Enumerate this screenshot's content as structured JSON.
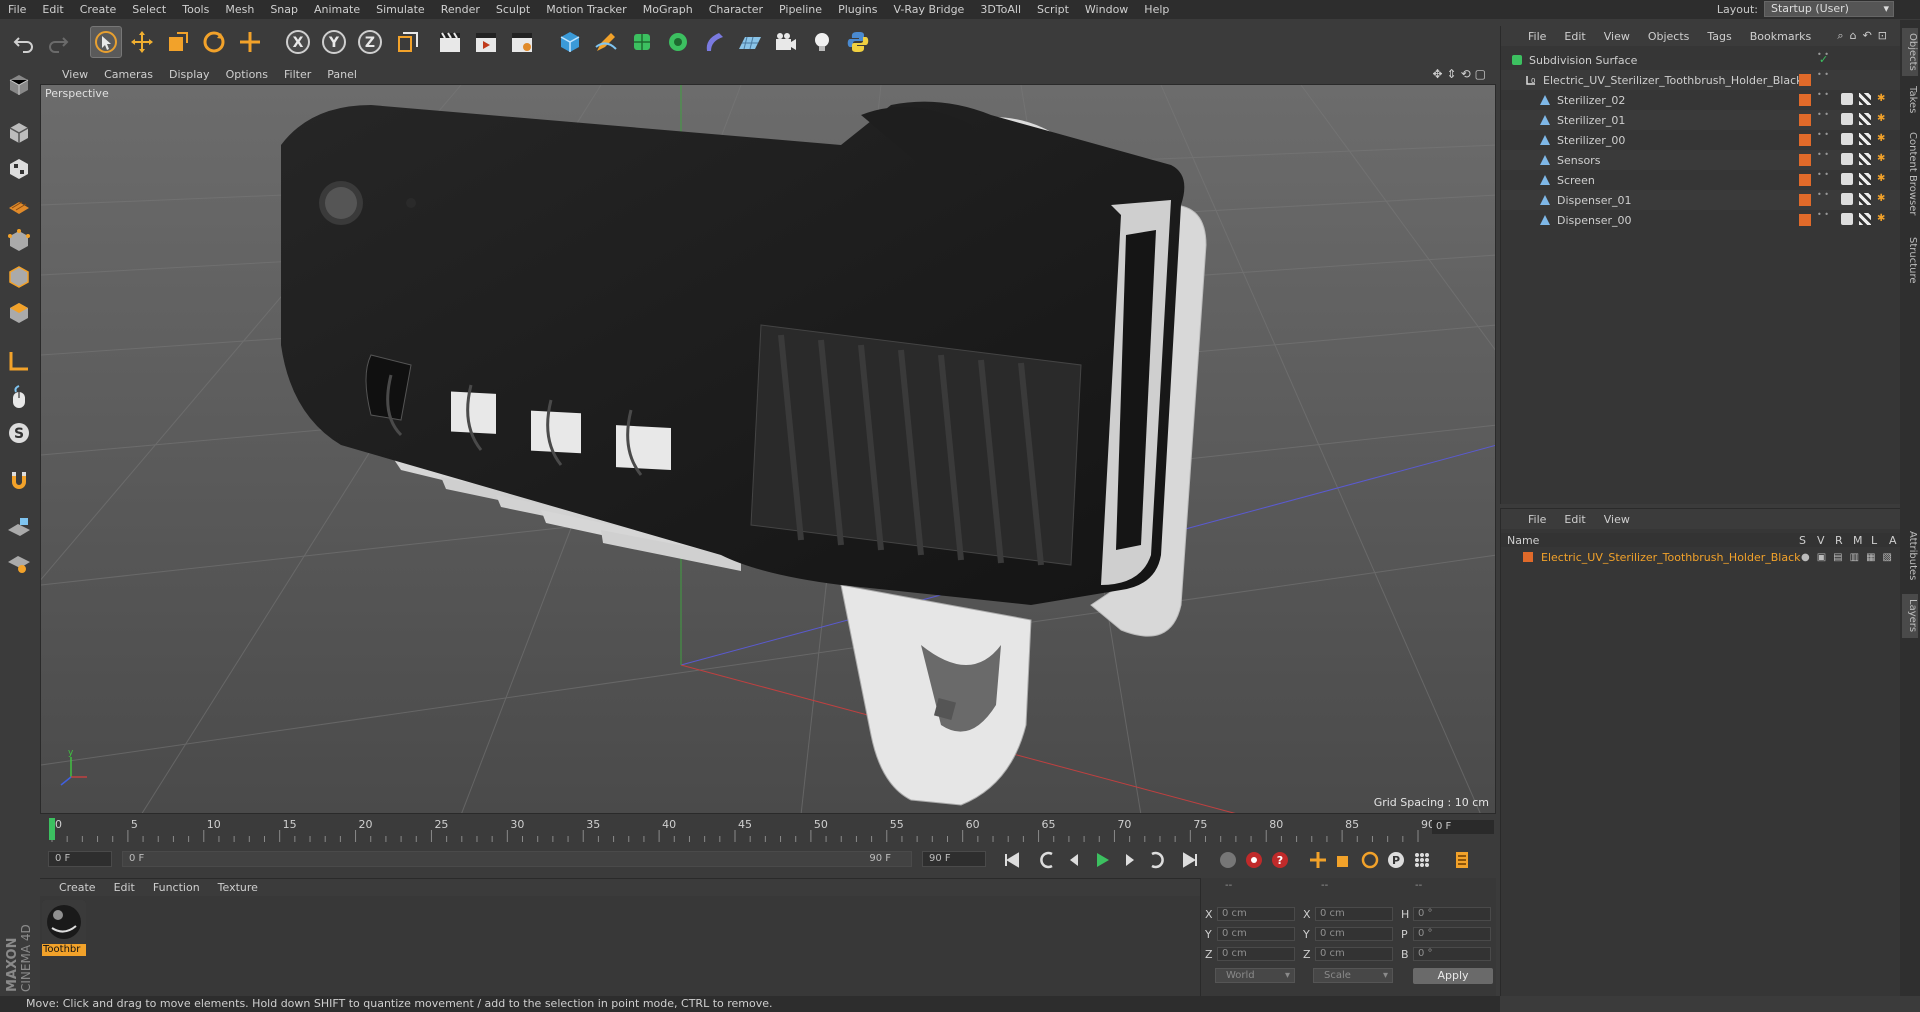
{
  "menubar": {
    "items": [
      "File",
      "Edit",
      "Create",
      "Select",
      "Tools",
      "Mesh",
      "Snap",
      "Animate",
      "Simulate",
      "Render",
      "Sculpt",
      "Motion Tracker",
      "MoGraph",
      "Character",
      "Pipeline",
      "Plugins",
      "V-Ray Bridge",
      "3DToAll",
      "Script",
      "Window",
      "Help"
    ],
    "layout_label": "Layout:",
    "layout_value": "Startup (User)"
  },
  "viewport": {
    "menu": [
      "View",
      "Cameras",
      "Display",
      "Options",
      "Filter",
      "Panel"
    ],
    "label": "Perspective",
    "grid_spacing": "Grid Spacing : 10 cm"
  },
  "timeline": {
    "ticks": [
      "0",
      "5",
      "10",
      "15",
      "20",
      "25",
      "30",
      "35",
      "40",
      "45",
      "50",
      "55",
      "60",
      "65",
      "70",
      "75",
      "80",
      "85",
      "90"
    ],
    "current_frame_right": "0 F",
    "start_field": "0 F",
    "range_left": "0 F",
    "range_right": "90 F",
    "end_field": "90 F",
    "current_frame_value": 0
  },
  "materials": {
    "menu": [
      "Create",
      "Edit",
      "Function",
      "Texture"
    ],
    "items": [
      {
        "name": "Toothbr"
      }
    ]
  },
  "coordinates": {
    "header": [
      "--",
      "--",
      "--"
    ],
    "rows": [
      {
        "l1": "X",
        "v1": "0 cm",
        "l2": "X",
        "v2": "0 cm",
        "l3": "H",
        "v3": "0 °"
      },
      {
        "l1": "Y",
        "v1": "0 cm",
        "l2": "Y",
        "v2": "0 cm",
        "l3": "P",
        "v3": "0 °"
      },
      {
        "l1": "Z",
        "v1": "0 cm",
        "l2": "Z",
        "v2": "0 cm",
        "l3": "B",
        "v3": "0 °"
      }
    ],
    "coord_system": "World",
    "mode": "Scale",
    "apply": "Apply"
  },
  "status": "Move: Click and drag to move elements. Hold down SHIFT to quantize movement / add to the selection in point mode, CTRL to remove.",
  "object_manager": {
    "menu": [
      "File",
      "Edit",
      "View",
      "Objects",
      "Tags",
      "Bookmarks"
    ],
    "objects": [
      {
        "name": "Subdivision Surface",
        "indent": 0,
        "type": "subdivision"
      },
      {
        "name": "Electric_UV_Sterilizer_Toothbrush_Holder_Black",
        "indent": 1,
        "type": "null"
      },
      {
        "name": "Sterilizer_02",
        "indent": 2,
        "type": "poly"
      },
      {
        "name": "Sterilizer_01",
        "indent": 2,
        "type": "poly"
      },
      {
        "name": "Sterilizer_00",
        "indent": 2,
        "type": "poly"
      },
      {
        "name": "Sensors",
        "indent": 2,
        "type": "poly"
      },
      {
        "name": "Screen",
        "indent": 2,
        "type": "poly"
      },
      {
        "name": "Dispenser_01",
        "indent": 2,
        "type": "poly"
      },
      {
        "name": "Dispenser_00",
        "indent": 2,
        "type": "poly"
      }
    ]
  },
  "layer_manager": {
    "menu": [
      "File",
      "Edit",
      "View"
    ],
    "columns": [
      "Name",
      "S",
      "V",
      "R",
      "M",
      "L",
      "A"
    ],
    "layers": [
      {
        "name": "Electric_UV_Sterilizer_Toothbrush_Holder_Black",
        "color": "#e06a2a"
      }
    ]
  },
  "right_tabs": [
    "Objects",
    "Takes",
    "Content Browser",
    "Structure",
    "Attributes",
    "Layers"
  ],
  "logo": {
    "brand": "MAXON",
    "product": "CINEMA 4D"
  },
  "colors": {
    "accent": "#f2a22a",
    "layer": "#e06a2a",
    "selected_text": "#f2a22a"
  }
}
